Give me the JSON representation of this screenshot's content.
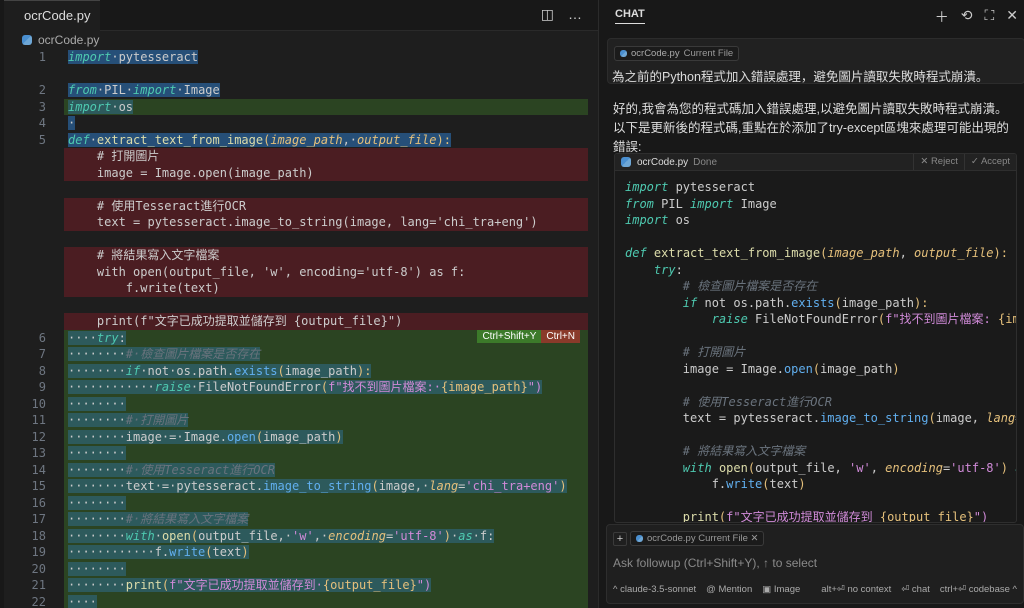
{
  "editor": {
    "tab": {
      "filename": "ocrCode.py",
      "modified": true
    },
    "breadcrumb": "ocrCode.py",
    "actions": {
      "split": "split-editor-icon",
      "more": "…"
    },
    "accept_shortcut": "Ctrl+Shift+Y",
    "reject_shortcut": "Ctrl+N",
    "rows": [
      {
        "n": "1",
        "t": "n",
        "sel": true,
        "tk": [
          [
            "import",
            "kw"
          ],
          [
            " pytesseract",
            ""
          ]
        ]
      },
      {
        "n": "",
        "t": "del",
        "tk": []
      },
      {
        "n": "2",
        "t": "n",
        "sel": true,
        "tk": [
          [
            "from",
            "kw"
          ],
          [
            " PIL ",
            ""
          ],
          [
            "import",
            "kw"
          ],
          [
            " Image",
            ""
          ]
        ]
      },
      {
        "n": "3",
        "t": "add",
        "sel": true,
        "tk": [
          [
            "import",
            "kw"
          ],
          [
            " os",
            ""
          ]
        ]
      },
      {
        "n": "4",
        "t": "n",
        "sel": true,
        "tk": [
          [
            " ",
            ""
          ]
        ]
      },
      {
        "n": "5",
        "t": "n",
        "sel": true,
        "tk": [
          [
            "def",
            "kw"
          ],
          [
            " ",
            ""
          ],
          [
            "extract_text_from_image",
            "fn"
          ],
          [
            "(",
            "br"
          ],
          [
            "image_path",
            "prm"
          ],
          [
            ", ",
            ""
          ],
          [
            "output_file",
            "prm"
          ],
          [
            "):",
            "br"
          ]
        ]
      },
      {
        "n": "",
        "t": "del",
        "tk": [
          [
            "    # 打開圖片",
            ""
          ]
        ]
      },
      {
        "n": "",
        "t": "del",
        "tk": [
          [
            "    image = Image.open(image_path)",
            ""
          ]
        ]
      },
      {
        "n": "",
        "t": "del",
        "tk": []
      },
      {
        "n": "",
        "t": "del",
        "tk": [
          [
            "    # 使用Tesseract進行OCR",
            ""
          ]
        ]
      },
      {
        "n": "",
        "t": "del",
        "tk": [
          [
            "    text = pytesseract.image_to_string(image, lang='chi_tra+eng')",
            ""
          ]
        ]
      },
      {
        "n": "",
        "t": "del",
        "tk": []
      },
      {
        "n": "",
        "t": "del",
        "tk": [
          [
            "    # 將結果寫入文字檔案",
            ""
          ]
        ]
      },
      {
        "n": "",
        "t": "del",
        "tk": [
          [
            "    with open(output_file, 'w', encoding='utf-8') as f:",
            ""
          ]
        ]
      },
      {
        "n": "",
        "t": "del",
        "tk": [
          [
            "        f.write(text)",
            ""
          ]
        ]
      },
      {
        "n": "",
        "t": "del",
        "tk": []
      },
      {
        "n": "",
        "t": "del",
        "tk": [
          [
            "    print(f\"文字已成功提取並儲存到 {output_file}\")",
            ""
          ]
        ]
      },
      {
        "n": "6",
        "t": "add",
        "sel": true,
        "tk": [
          [
            "    ",
            ""
          ],
          [
            "try",
            "kw"
          ],
          [
            ":",
            ""
          ]
        ]
      },
      {
        "n": "7",
        "t": "add",
        "sel": true,
        "tk": [
          [
            "        ",
            ""
          ],
          [
            "# 檢查圖片檔案是否存在",
            "cm"
          ]
        ]
      },
      {
        "n": "8",
        "t": "add",
        "sel": true,
        "tk": [
          [
            "        ",
            ""
          ],
          [
            "if",
            "kw"
          ],
          [
            " not os.path.",
            ""
          ],
          [
            "exists",
            "meth"
          ],
          [
            "(",
            "br"
          ],
          [
            "image_path",
            ""
          ],
          [
            "):",
            "br"
          ]
        ]
      },
      {
        "n": "9",
        "t": "add",
        "sel": true,
        "tk": [
          [
            "            ",
            ""
          ],
          [
            "raise",
            "kw"
          ],
          [
            " FileNotFoundError",
            ""
          ],
          [
            "(",
            "br"
          ],
          [
            "f\"找不到圖片檔案: ",
            "str"
          ],
          [
            "{image_path}",
            "br"
          ],
          [
            "\")",
            "str"
          ]
        ]
      },
      {
        "n": "10",
        "t": "add",
        "sel": true,
        "tk": [
          [
            "        ",
            ""
          ]
        ]
      },
      {
        "n": "11",
        "t": "add",
        "sel": true,
        "tk": [
          [
            "        ",
            ""
          ],
          [
            "# 打開圖片",
            "cm"
          ]
        ]
      },
      {
        "n": "12",
        "t": "add",
        "sel": true,
        "tk": [
          [
            "        image = Image.",
            ""
          ],
          [
            "open",
            "meth"
          ],
          [
            "(",
            "br"
          ],
          [
            "image_path",
            ""
          ],
          [
            ")",
            "br"
          ]
        ]
      },
      {
        "n": "13",
        "t": "add",
        "sel": true,
        "tk": [
          [
            "        ",
            ""
          ]
        ]
      },
      {
        "n": "14",
        "t": "add",
        "sel": true,
        "tk": [
          [
            "        ",
            ""
          ],
          [
            "# 使用Tesseract進行OCR",
            "cm"
          ]
        ]
      },
      {
        "n": "15",
        "t": "add",
        "sel": true,
        "tk": [
          [
            "        text = pytesseract.",
            ""
          ],
          [
            "image_to_string",
            "meth"
          ],
          [
            "(",
            "br"
          ],
          [
            "image, ",
            ""
          ],
          [
            "lang",
            "prm"
          ],
          [
            "=",
            ""
          ],
          [
            "'chi_tra+eng'",
            "str"
          ],
          [
            ")",
            "br"
          ]
        ]
      },
      {
        "n": "16",
        "t": "add",
        "sel": true,
        "tk": [
          [
            "        ",
            ""
          ]
        ]
      },
      {
        "n": "17",
        "t": "add",
        "sel": true,
        "tk": [
          [
            "        ",
            ""
          ],
          [
            "# 將結果寫入文字檔案",
            "cm"
          ]
        ]
      },
      {
        "n": "18",
        "t": "add",
        "sel": true,
        "tk": [
          [
            "        ",
            ""
          ],
          [
            "with",
            "kw"
          ],
          [
            " ",
            ""
          ],
          [
            "open",
            "fn"
          ],
          [
            "(",
            "br"
          ],
          [
            "output_file, ",
            ""
          ],
          [
            "'w'",
            "str"
          ],
          [
            ", ",
            ""
          ],
          [
            "encoding",
            "prm"
          ],
          [
            "=",
            ""
          ],
          [
            "'utf-8'",
            "str"
          ],
          [
            ")",
            "br"
          ],
          [
            " ",
            ""
          ],
          [
            "as",
            "kw"
          ],
          [
            " f:",
            ""
          ]
        ]
      },
      {
        "n": "19",
        "t": "add",
        "sel": true,
        "tk": [
          [
            "            f.",
            ""
          ],
          [
            "write",
            "meth"
          ],
          [
            "(",
            "br"
          ],
          [
            "text",
            ""
          ],
          [
            ")",
            "br"
          ]
        ]
      },
      {
        "n": "20",
        "t": "add",
        "sel": true,
        "tk": [
          [
            "        ",
            ""
          ]
        ]
      },
      {
        "n": "21",
        "t": "add",
        "sel": true,
        "tk": [
          [
            "        ",
            ""
          ],
          [
            "print",
            "fn"
          ],
          [
            "(",
            "br"
          ],
          [
            "f\"文字已成功提取並儲存到 ",
            "str"
          ],
          [
            "{output_file}",
            "br"
          ],
          [
            "\")",
            "str"
          ]
        ]
      },
      {
        "n": "22",
        "t": "add",
        "sel": true,
        "tk": [
          [
            "    ",
            ""
          ]
        ]
      }
    ]
  },
  "chat": {
    "title": "CHAT",
    "header_icons": [
      "plus-icon",
      "history-icon",
      "maximize-icon",
      "close-icon"
    ],
    "user_message": {
      "file": "ocrCode.py",
      "file_label": "Current File",
      "text": "為之前的Python程式加入錯誤處理，避免圖片讀取失敗時程式崩潰。"
    },
    "reply": "好的,我會為您的程式碼加入錯誤處理,以避免圖片讀取失敗時程式崩潰。以下是更新後的程式碼,重點在於添加了try-except區塊來處理可能出現的錯誤:",
    "code_block": {
      "file": "ocrCode.py",
      "status": "Done",
      "reject": "✕ Reject",
      "accept": "✓ Accept",
      "lines": [
        [
          [
            "import",
            "kw"
          ],
          [
            " pytesseract",
            ""
          ]
        ],
        [
          [
            "from",
            "kw"
          ],
          [
            " PIL ",
            ""
          ],
          [
            "import",
            "kw"
          ],
          [
            " Image",
            ""
          ]
        ],
        [
          [
            "import",
            "kw"
          ],
          [
            " os",
            ""
          ]
        ],
        [],
        [
          [
            "def",
            "kw"
          ],
          [
            " ",
            ""
          ],
          [
            "extract_text_from_image",
            "fn"
          ],
          [
            "(",
            "br"
          ],
          [
            "image_path",
            "prm"
          ],
          [
            ", ",
            ""
          ],
          [
            "output_file",
            "prm"
          ],
          [
            "):",
            "br"
          ]
        ],
        [
          [
            "    ",
            ""
          ],
          [
            "try",
            "kw"
          ],
          [
            ":",
            ""
          ]
        ],
        [
          [
            "        ",
            ""
          ],
          [
            "# 檢查圖片檔案是否存在",
            "cm"
          ]
        ],
        [
          [
            "        ",
            ""
          ],
          [
            "if",
            "kw"
          ],
          [
            " not os.path.",
            ""
          ],
          [
            "exists",
            "meth"
          ],
          [
            "(",
            "br"
          ],
          [
            "image_path",
            ""
          ],
          [
            "):",
            "br"
          ]
        ],
        [
          [
            "            ",
            ""
          ],
          [
            "raise",
            "kw"
          ],
          [
            " FileNotFoundError",
            ""
          ],
          [
            "(",
            "br"
          ],
          [
            "f\"找不到圖片檔案: ",
            "str"
          ],
          [
            "{image_path}",
            "br"
          ],
          [
            "\")",
            "str"
          ]
        ],
        [],
        [
          [
            "        ",
            ""
          ],
          [
            "# 打開圖片",
            "cm"
          ]
        ],
        [
          [
            "        image = Image.",
            ""
          ],
          [
            "open",
            "meth"
          ],
          [
            "(",
            "br"
          ],
          [
            "image_path",
            ""
          ],
          [
            ")",
            "br"
          ]
        ],
        [],
        [
          [
            "        ",
            ""
          ],
          [
            "# 使用Tesseract進行OCR",
            "cm"
          ]
        ],
        [
          [
            "        text = pytesseract.",
            ""
          ],
          [
            "image_to_string",
            "meth"
          ],
          [
            "(",
            "br"
          ],
          [
            "image, ",
            ""
          ],
          [
            "lang",
            "prm"
          ],
          [
            "=",
            ""
          ],
          [
            "'chi_tra+eng'",
            "str"
          ],
          [
            ")",
            "br"
          ]
        ],
        [],
        [
          [
            "        ",
            ""
          ],
          [
            "# 將結果寫入文字檔案",
            "cm"
          ]
        ],
        [
          [
            "        ",
            ""
          ],
          [
            "with",
            "kw"
          ],
          [
            " ",
            ""
          ],
          [
            "open",
            "fn"
          ],
          [
            "(",
            "br"
          ],
          [
            "output_file, ",
            ""
          ],
          [
            "'w'",
            "str"
          ],
          [
            ", ",
            ""
          ],
          [
            "encoding",
            "prm"
          ],
          [
            "=",
            ""
          ],
          [
            "'utf-8'",
            "str"
          ],
          [
            ")",
            "br"
          ],
          [
            " ",
            ""
          ],
          [
            "as",
            "kw"
          ],
          [
            " f:",
            ""
          ]
        ],
        [
          [
            "            f.",
            ""
          ],
          [
            "write",
            "meth"
          ],
          [
            "(",
            "br"
          ],
          [
            "text",
            ""
          ],
          [
            ")",
            "br"
          ]
        ],
        [],
        [
          [
            "        ",
            ""
          ],
          [
            "print",
            "fn"
          ],
          [
            "(",
            "br"
          ],
          [
            "f\"文字已成功提取並儲存到 ",
            "str"
          ],
          [
            "{output_file}",
            "br"
          ],
          [
            "\")",
            "str"
          ]
        ]
      ]
    },
    "input": {
      "file": "ocrCode.py",
      "file_label": "Current File",
      "placeholder": "Ask followup (Ctrl+Shift+Y), ↑ to select"
    },
    "footer": {
      "model": "^ claude-3.5-sonnet",
      "mention": "@ Mention",
      "image": "Image",
      "no_context": "alt+⏎ no context",
      "chat": "⏎ chat",
      "codebase": "ctrl+⏎ codebase ^"
    }
  }
}
